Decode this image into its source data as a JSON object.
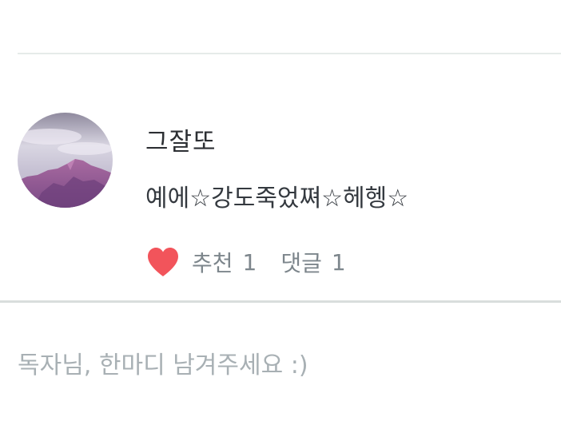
{
  "comment": {
    "author": "그잘또",
    "text": "예에☆강도죽었쪄☆헤헹☆",
    "like_label": "추천",
    "like_count": "1",
    "reply_label": "댓글",
    "reply_count": "1"
  },
  "input": {
    "placeholder": "독자님, 한마디 남겨주세요 :)"
  },
  "colors": {
    "heart": "#f2545b",
    "divider": "#e6ebe9",
    "muted_text": "#7d868c"
  },
  "icons": {
    "like": "heart-icon"
  }
}
